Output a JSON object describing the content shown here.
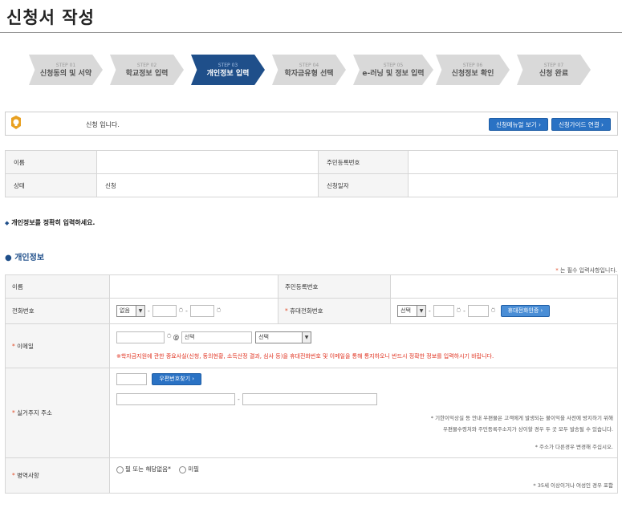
{
  "page_title": "신청서 작성",
  "steps": [
    {
      "num": "STEP 01",
      "label": "신청동의 및 서약"
    },
    {
      "num": "STEP 02",
      "label": "학교정보 입력"
    },
    {
      "num": "STEP 03",
      "label": "개인정보 입력"
    },
    {
      "num": "STEP 04",
      "label": "학자금유형 선택"
    },
    {
      "num": "STEP 05",
      "label": "e-러닝 및 정보 입력"
    },
    {
      "num": "STEP 06",
      "label": "신청정보 확인"
    },
    {
      "num": "STEP 07",
      "label": "신청 완료"
    }
  ],
  "active_step": 3,
  "notice": {
    "text": "신청 입니다.",
    "manual_button": "신청메뉴얼 보기 ›",
    "guide_button": "신청가이드 연결 ›"
  },
  "info_table": {
    "name_label": "이름",
    "name_value": "",
    "rrn_label": "주민등록번호",
    "rrn_value": "",
    "status_label": "상태",
    "status_value": "신청",
    "date_label": "신청일자",
    "date_value": ""
  },
  "guide_text": "개인정보를 정확히 입력하세요.",
  "section_title": "개인정보",
  "required_note_star": "*",
  "required_note": " 는 필수 입력사항입니다.",
  "form": {
    "name_label": "이름",
    "rrn_label": "주민등록번호",
    "phone_label": "전화번호",
    "phone_select": "없음",
    "mobile_label": "휴대전화번호",
    "mobile_select": "선택",
    "mobile_verify_button": "휴대전화인증 ›",
    "email_label": "이메일",
    "email_domain_placeholder": "선택",
    "email_select": "선택",
    "email_warning": "※학자금지원에 관한 중요사실(신청, 동의현황, 소득산정 결과, 심사 등)을 휴대전화번호 및 이메일을 통해 통지하오니 반드시 정확한 정보를 입력하시기 바랍니다.",
    "address_label": "실거주지 주소",
    "zip_button": "우편번호찾기 ›",
    "address_note1": "* 기한이익상실 등 안내 우편물은 고객에게 발생되는 불이익을 사전에 방지하기 위해",
    "address_note2": "우편물수령처와 주민등록주소지가 상이할 경우 두 곳 모두 발송될 수 있습니다.",
    "address_note3": "* 주소가 다른경우 변경해 주십시오.",
    "military_label": "병역사항",
    "military_opt1": "필 또는 해당없음*",
    "military_opt2": "미필",
    "military_note": "* 35세 이상이거나 여성인 경우 포함"
  },
  "colors": {
    "accent": "#1f4f8a",
    "button": "#2a72c4",
    "warning": "#e0301e"
  }
}
